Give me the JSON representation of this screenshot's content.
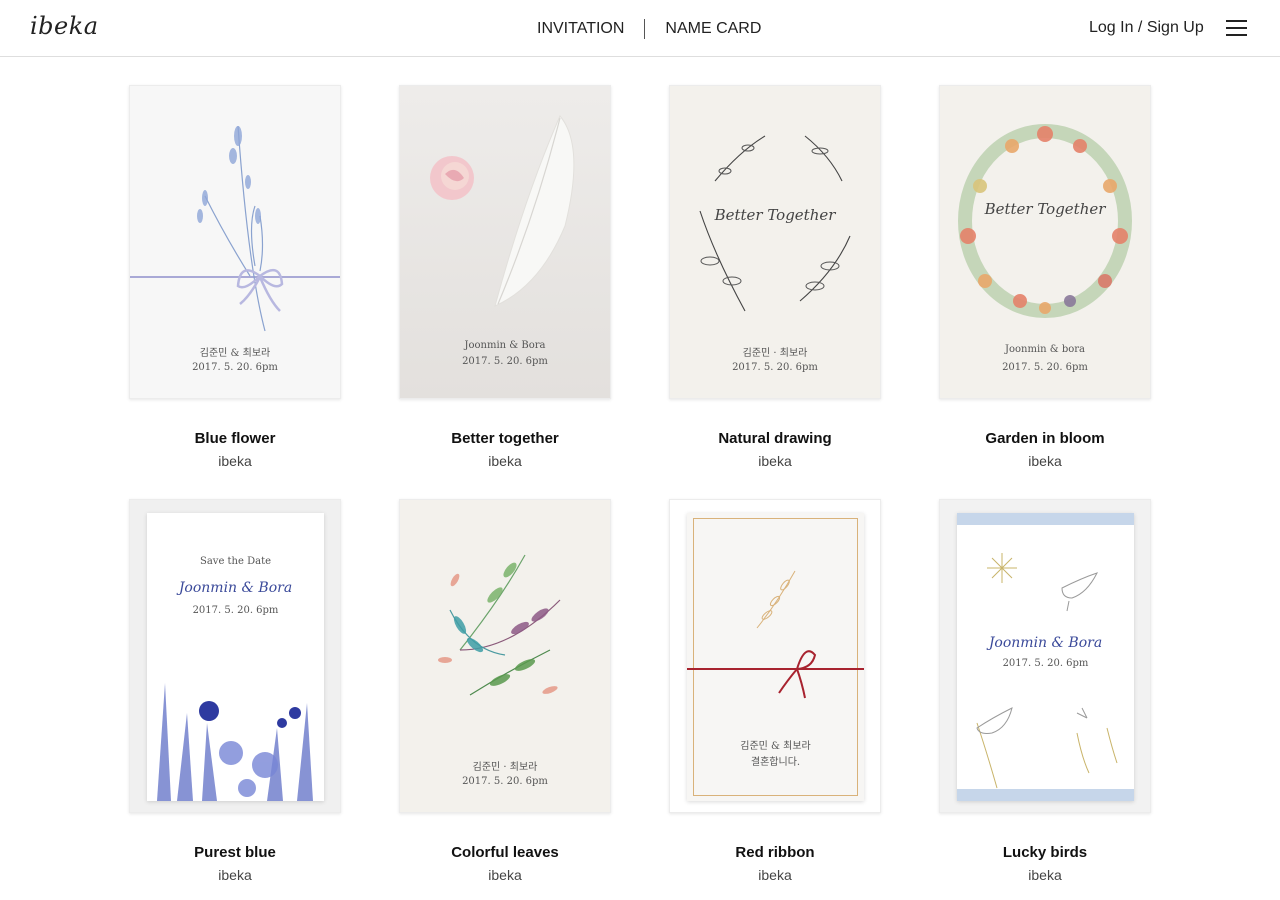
{
  "header": {
    "logo": "ibeka",
    "nav": [
      "INVITATION",
      "NAME CARD"
    ],
    "login": "Log In / Sign Up",
    "menu_icon": "hamburger-menu-icon"
  },
  "cards": [
    {
      "title": "Blue flower",
      "author": "ibeka",
      "names": "김준민 & 최보라",
      "date": "2017. 5. 20. 6pm"
    },
    {
      "title": "Better together",
      "author": "ibeka",
      "names": "Joonmin & Bora",
      "date": "2017. 5. 20. 6pm"
    },
    {
      "title": "Natural drawing",
      "author": "ibeka",
      "script": "Better Together",
      "names": "김준민 · 최보라",
      "date": "2017. 5. 20. 6pm"
    },
    {
      "title": "Garden in bloom",
      "author": "ibeka",
      "script": "Better Together",
      "names": "Joonmin & bora",
      "date": "2017. 5. 20. 6pm"
    },
    {
      "title": "Purest blue",
      "author": "ibeka",
      "top": "Save the Date",
      "script": "Joonmin & Bora",
      "date": "2017. 5. 20. 6pm"
    },
    {
      "title": "Colorful leaves",
      "author": "ibeka",
      "names": "김준민 · 최보라",
      "date": "2017. 5. 20. 6pm"
    },
    {
      "title": "Red ribbon",
      "author": "ibeka",
      "names": "김준민 & 최보라",
      "line2": "결혼합니다."
    },
    {
      "title": "Lucky birds",
      "author": "ibeka",
      "script": "Joonmin & Bora",
      "date": "2017. 5. 20. 6pm"
    }
  ]
}
